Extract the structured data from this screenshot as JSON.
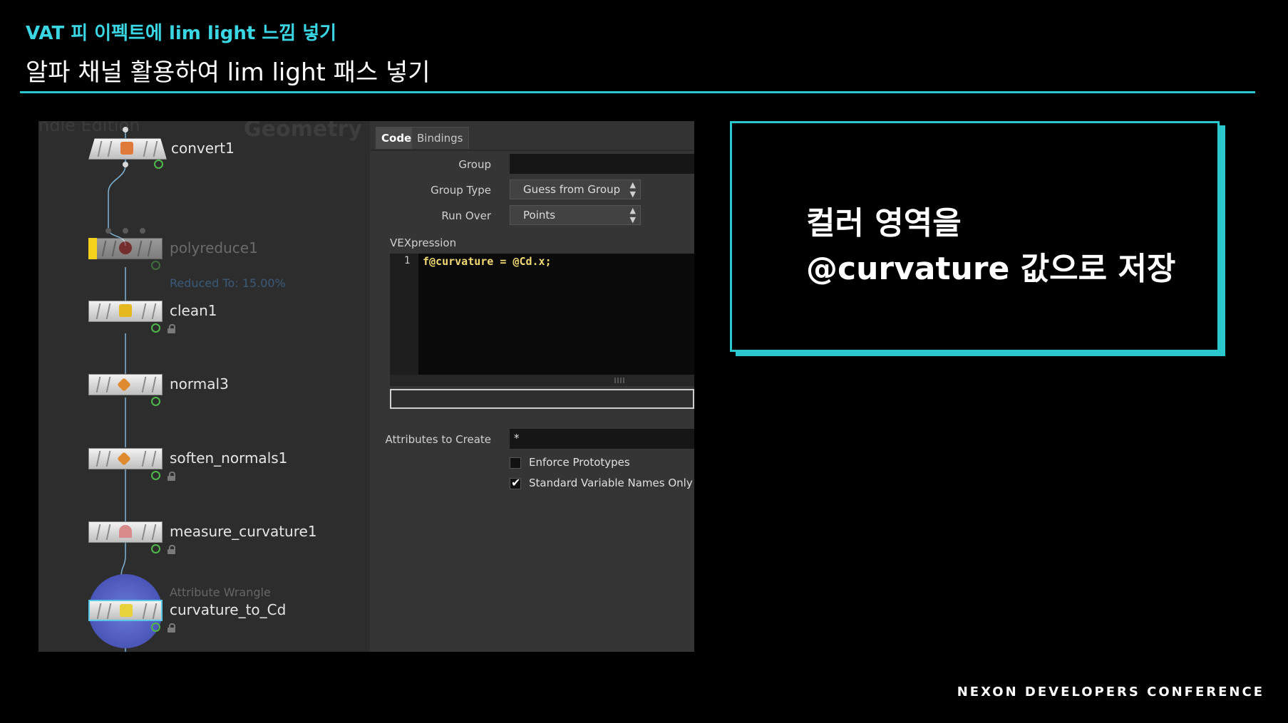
{
  "slide": {
    "subtitle": "VAT 피 이펙트에 lim light 느낌 넣기",
    "title": "알파 채널 활용하여 lim light 패스 넣기",
    "footer": "NEXON DEVELOPERS CONFERENCE"
  },
  "network": {
    "watermark_left": "ndle Edition",
    "watermark_context": "Geometry",
    "nodes": [
      {
        "name": "convert1",
        "icon": "convert-icon",
        "bypassed": false,
        "locked": false
      },
      {
        "name": "polyreduce1",
        "icon": "polyreduce-icon",
        "bypassed": true,
        "locked": false,
        "note": "Reduced To: 15.00%"
      },
      {
        "name": "clean1",
        "icon": "broom-icon",
        "bypassed": false,
        "locked": true
      },
      {
        "name": "normal3",
        "icon": "normal-icon",
        "bypassed": false,
        "locked": false
      },
      {
        "name": "soften_normals1",
        "icon": "normal-icon",
        "bypassed": false,
        "locked": true
      },
      {
        "name": "measure_curvature1",
        "icon": "curvature-icon",
        "bypassed": false,
        "locked": true
      },
      {
        "name": "curvature_to_Cd",
        "type_label": "Attribute Wrangle",
        "icon": "wrangle-icon",
        "selected": true,
        "locked": true
      }
    ]
  },
  "params": {
    "tabs": [
      "Code",
      "Bindings"
    ],
    "active_tab": "Code",
    "group_label": "Group",
    "group_value": "",
    "group_type_label": "Group Type",
    "group_type_value": "Guess from Group",
    "run_over_label": "Run Over",
    "run_over_value": "Points",
    "vex_label": "VEXpression",
    "code_line_number": "1",
    "code_line": "f@curvature = @Cd.x;",
    "attrs_label": "Attributes to Create",
    "attrs_value": "*",
    "enforce_label": "Enforce Prototypes",
    "enforce_checked": false,
    "stdvar_label": "Standard Variable Names Only",
    "stdvar_checked": true
  },
  "callout": {
    "line1": "컬러 영역을",
    "line2": "@curvature 값으로 저장",
    "accent_color": "#2bc7cf"
  }
}
